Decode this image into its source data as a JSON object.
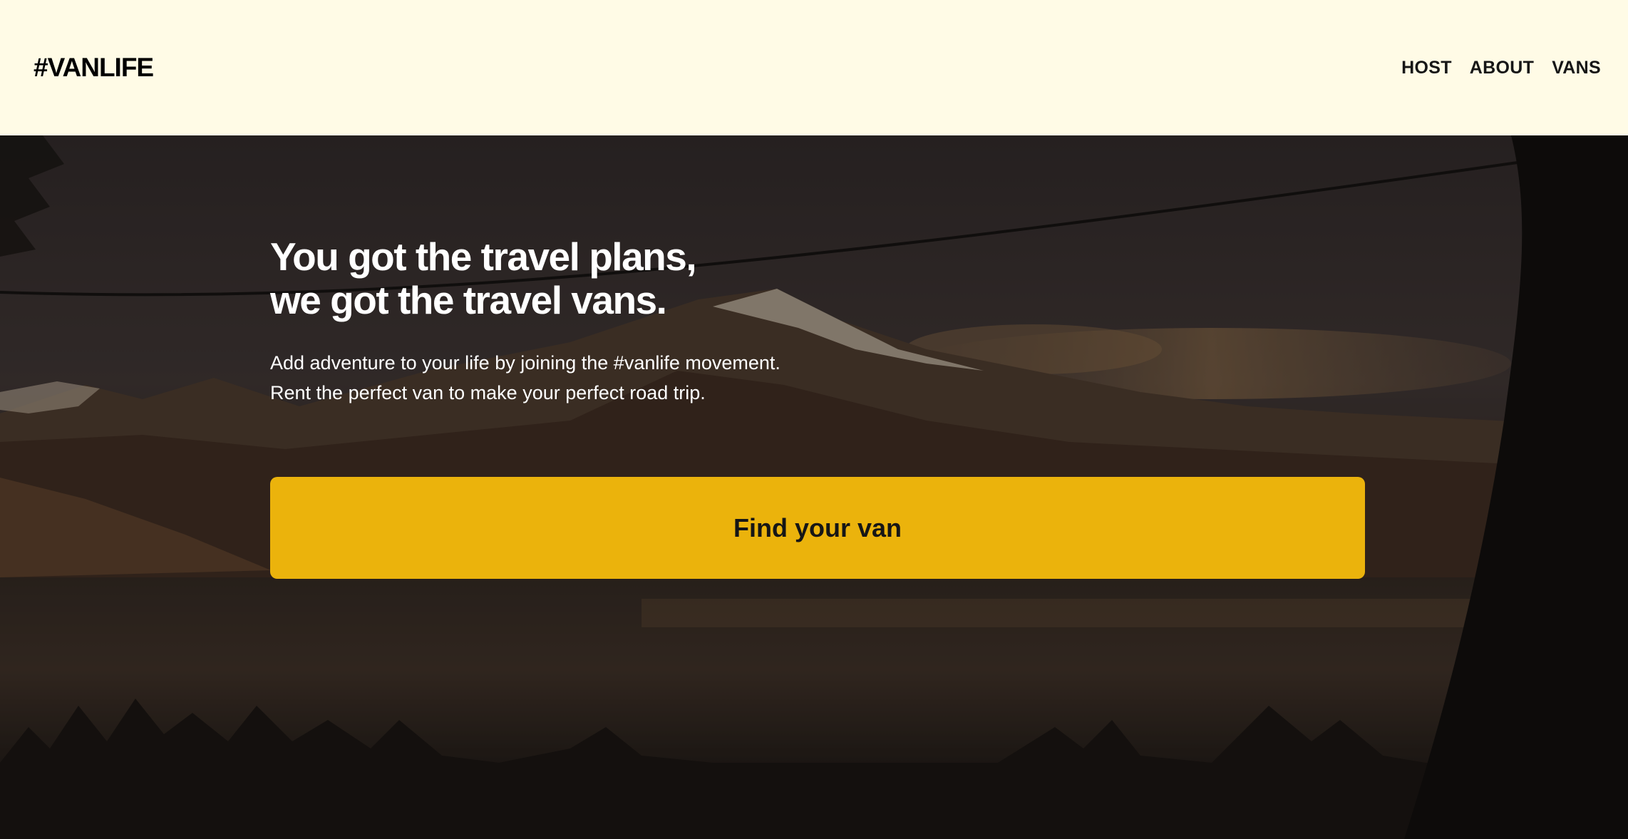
{
  "header": {
    "logo": "#VANLIFE",
    "nav": [
      {
        "label": "HOST"
      },
      {
        "label": "ABOUT"
      },
      {
        "label": "VANS"
      }
    ]
  },
  "hero": {
    "title_line1": "You got the travel plans,",
    "title_line2": "we got the travel vans.",
    "text_line1": "Add adventure to your life by joining the #vanlife movement.",
    "text_line2": "Rent the perfect van to make your perfect road trip.",
    "cta_label": "Find your van"
  },
  "colors": {
    "header_bg": "#FFFBE6",
    "cta_bg": "#EBB30C",
    "text_dark": "#161616",
    "hero_text": "#FFFFFF"
  }
}
